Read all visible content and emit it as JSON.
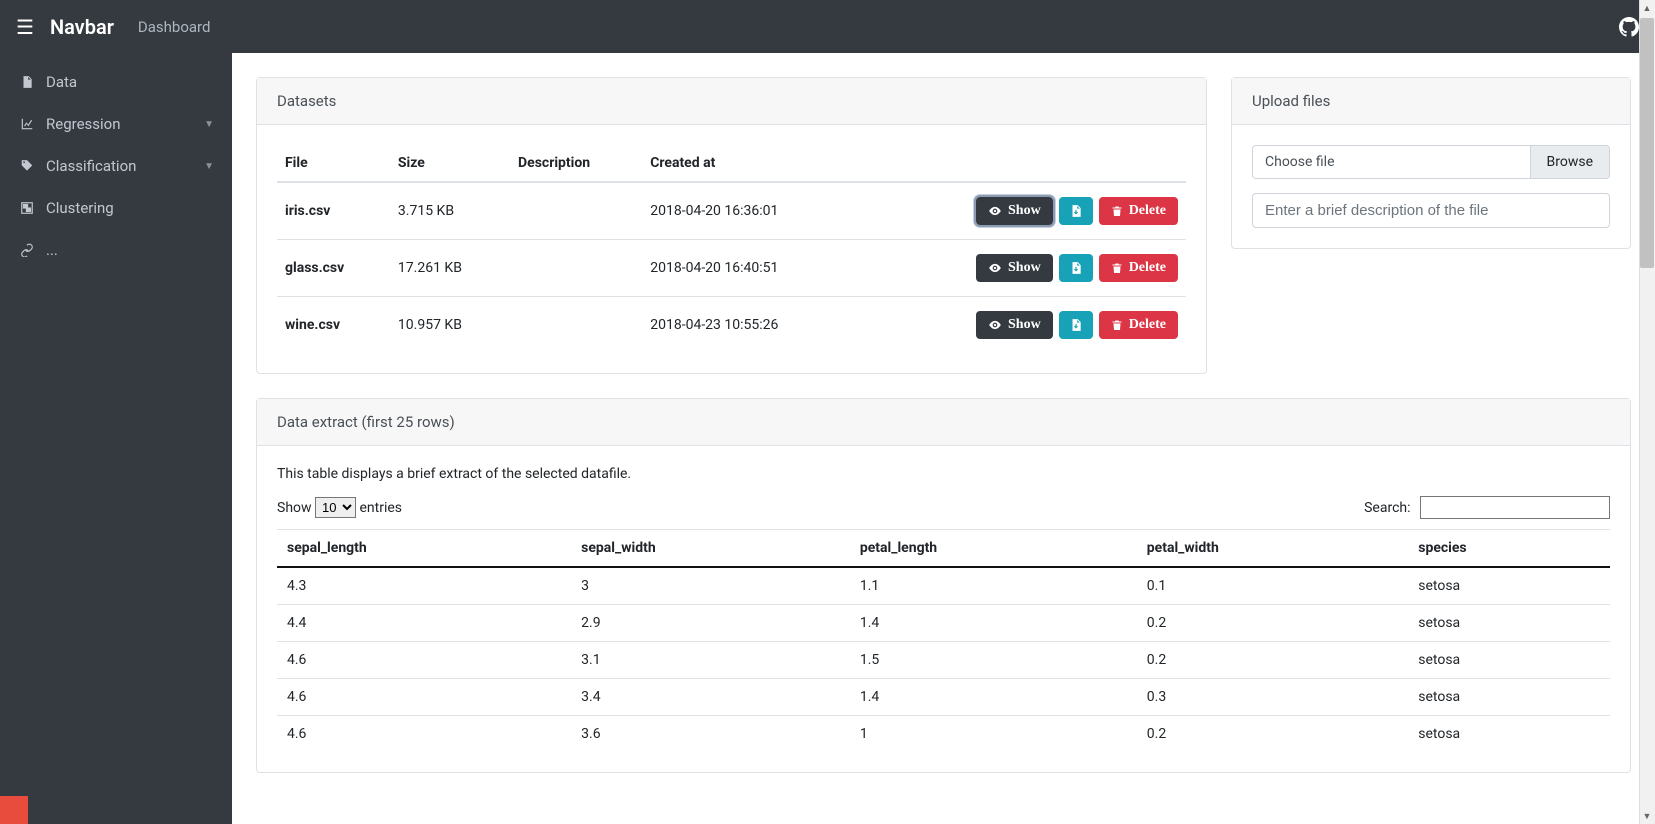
{
  "navbar": {
    "brand": "Navbar",
    "dashboard": "Dashboard"
  },
  "sidebar": {
    "items": [
      {
        "label": "Data"
      },
      {
        "label": "Regression"
      },
      {
        "label": "Classification"
      },
      {
        "label": "Clustering"
      },
      {
        "label": "..."
      }
    ]
  },
  "datasets": {
    "title": "Datasets",
    "headers": {
      "file": "File",
      "size": "Size",
      "description": "Description",
      "created": "Created at"
    },
    "actions": {
      "show": "Show",
      "delete": "Delete"
    },
    "rows": [
      {
        "file": "iris.csv",
        "size": "3.715 KB",
        "description": "",
        "created": "2018-04-20 16:36:01"
      },
      {
        "file": "glass.csv",
        "size": "17.261 KB",
        "description": "",
        "created": "2018-04-20 16:40:51"
      },
      {
        "file": "wine.csv",
        "size": "10.957 KB",
        "description": "",
        "created": "2018-04-23 10:55:26"
      }
    ]
  },
  "upload": {
    "title": "Upload files",
    "choose": "Choose file",
    "browse": "Browse",
    "desc_placeholder": "Enter a brief description of the file"
  },
  "extract": {
    "title": "Data extract (first 25 rows)",
    "intro": "This table displays a brief extract of the selected datafile.",
    "show_label": "Show",
    "entries_label": "entries",
    "length_value": "10",
    "search_label": "Search:",
    "headers": [
      "sepal_length",
      "sepal_width",
      "petal_length",
      "petal_width",
      "species"
    ],
    "rows": [
      [
        "4.3",
        "3",
        "1.1",
        "0.1",
        "setosa"
      ],
      [
        "4.4",
        "2.9",
        "1.4",
        "0.2",
        "setosa"
      ],
      [
        "4.6",
        "3.1",
        "1.5",
        "0.2",
        "setosa"
      ],
      [
        "4.6",
        "3.4",
        "1.4",
        "0.3",
        "setosa"
      ],
      [
        "4.6",
        "3.6",
        "1",
        "0.2",
        "setosa"
      ]
    ]
  }
}
